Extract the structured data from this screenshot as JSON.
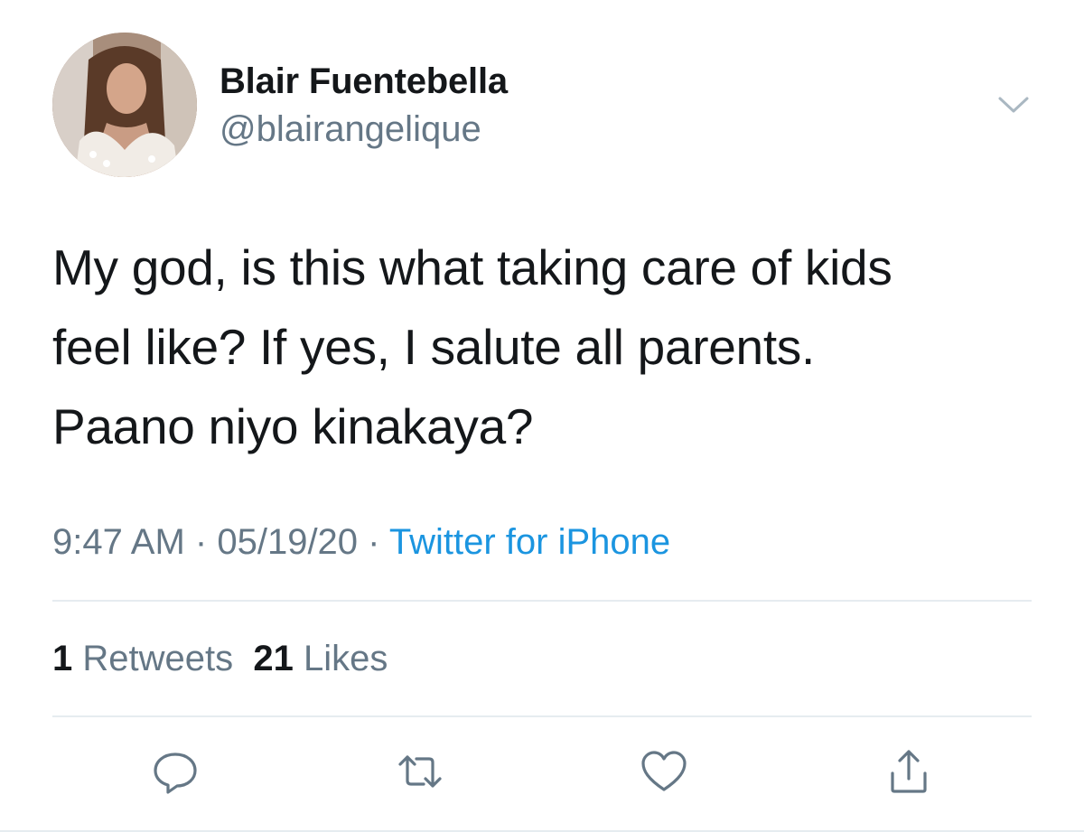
{
  "user": {
    "display_name": "Blair Fuentebella",
    "handle": "@blairangelique",
    "avatar_icon": "profile-photo"
  },
  "tweet": {
    "lines": [
      "My god, is this what taking care of kids",
      "feel like? If yes, I salute all parents.",
      "Paano niyo kinakaya?"
    ],
    "time": "9:47 AM",
    "date": "05/19/20",
    "separator": "·",
    "source": "Twitter for iPhone"
  },
  "stats": {
    "retweets_count": "1",
    "retweets_label": "Retweets",
    "likes_count": "21",
    "likes_label": "Likes"
  },
  "actions": [
    "reply-icon",
    "retweet-icon",
    "like-icon",
    "share-icon"
  ],
  "colors": {
    "text": "#14171a",
    "secondary": "#657786",
    "link": "#1b95e0",
    "divider": "#e6ecf0"
  }
}
